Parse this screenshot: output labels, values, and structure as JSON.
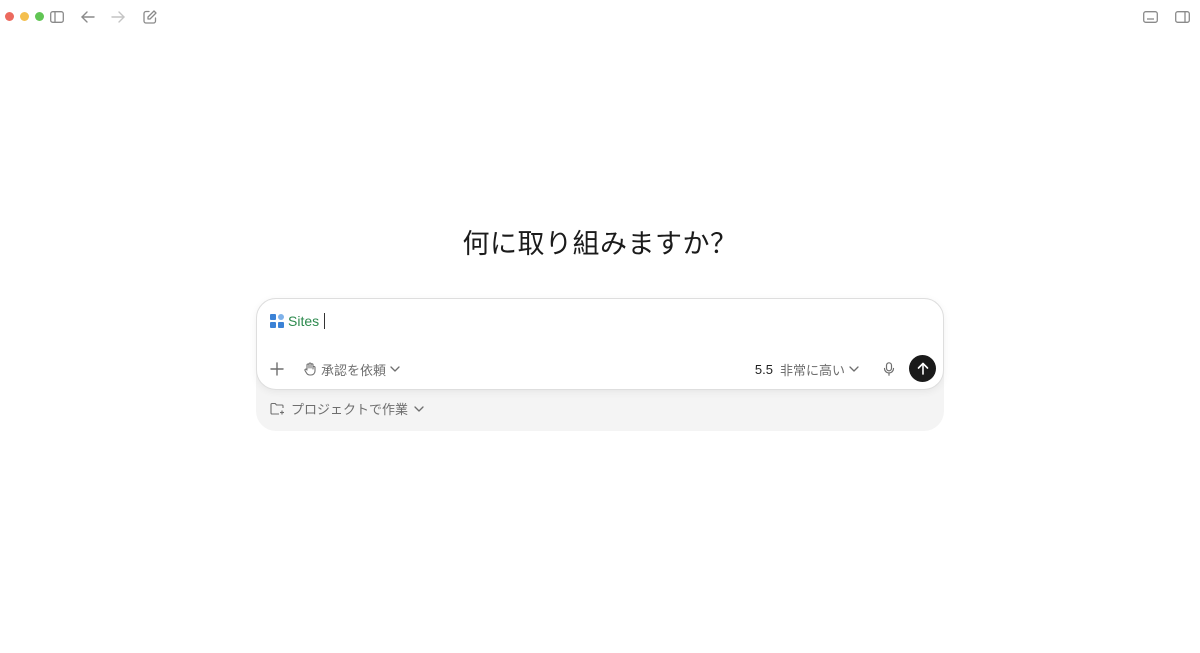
{
  "window": {
    "traffic_colors": {
      "close": "#ec6a5e",
      "minimize": "#f4bf4f",
      "zoom": "#61c554"
    },
    "icons": [
      "sidebar-toggle-icon",
      "back-arrow-icon",
      "forward-arrow-icon",
      "new-chat-icon",
      "bottom-panel-icon",
      "right-panel-icon"
    ]
  },
  "main": {
    "heading": "何に取り組みますか？"
  },
  "composer": {
    "chip_label": "Sites",
    "chip_color": "#2d8a4e",
    "approval_label": "承認を依頼",
    "model_version": "5.5",
    "effort_label": "非常に高い",
    "project_label": "プロジェクトで作業"
  }
}
